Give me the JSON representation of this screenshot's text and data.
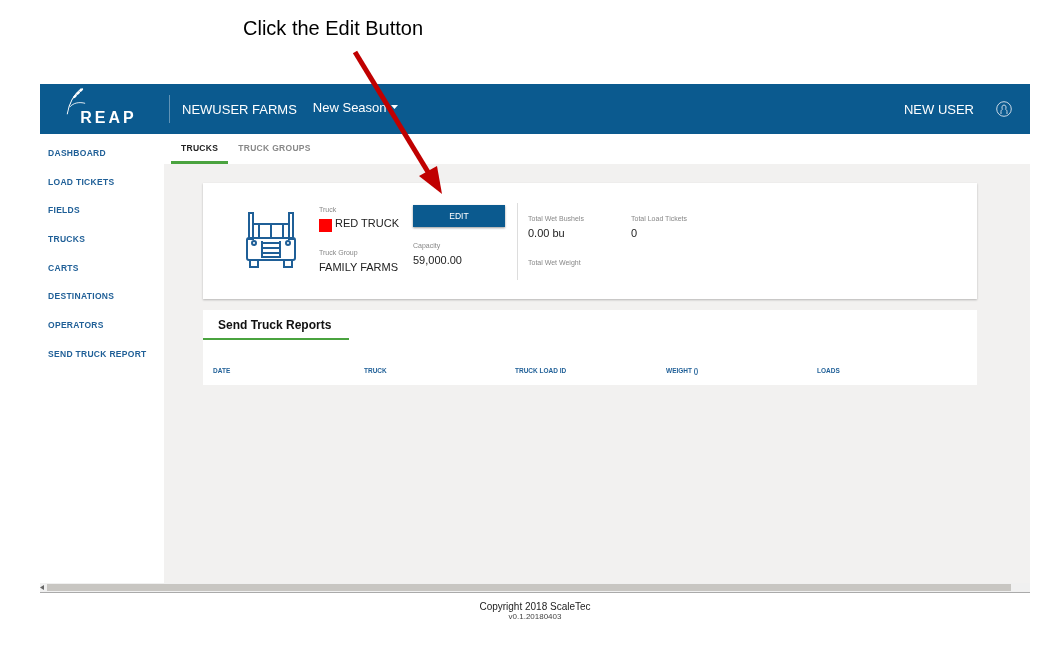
{
  "annotation": {
    "text": "Click the Edit Button"
  },
  "header": {
    "brand": "REAP",
    "farm": "NEWUSER FARMS",
    "season": "New Season",
    "user": "NEW USER"
  },
  "sidebar": {
    "items": [
      {
        "label": "DASHBOARD"
      },
      {
        "label": "LOAD TICKETS"
      },
      {
        "label": "FIELDS"
      },
      {
        "label": "TRUCKS"
      },
      {
        "label": "CARTS"
      },
      {
        "label": "DESTINATIONS"
      },
      {
        "label": "OPERATORS"
      },
      {
        "label": "SEND TRUCK REPORT"
      }
    ]
  },
  "tabs": [
    {
      "label": "TRUCKS",
      "selected": true
    },
    {
      "label": "TRUCK GROUPS",
      "selected": false
    }
  ],
  "truck": {
    "truck_label": "Truck",
    "name": "RED TRUCK",
    "color": "#ff0000",
    "group_label": "Truck Group",
    "group": "FAMILY FARMS",
    "edit_button": "EDIT",
    "capacity_label": "Capacity",
    "capacity": "59,000.00",
    "stats": [
      {
        "label": "Total Wet Bushels",
        "value": "0.00 bu"
      },
      {
        "label": "Total Load Tickets",
        "value": "0"
      },
      {
        "label": "Total Wet Weight"
      }
    ]
  },
  "reports": {
    "title": "Send Truck Reports",
    "columns": [
      "DATE",
      "TRUCK",
      "TRUCK LOAD ID",
      "WEIGHT ()",
      "LOADS"
    ]
  },
  "footer": {
    "copyright": "Copyright 2018 ScaleTec",
    "version": "v0.1.20180403"
  }
}
